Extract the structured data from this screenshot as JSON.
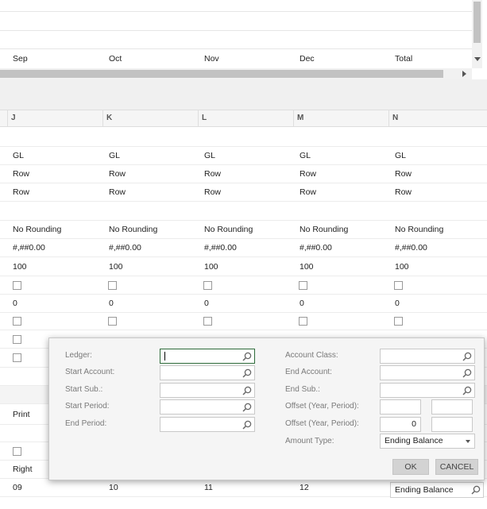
{
  "months": {
    "sep": "Sep",
    "oct": "Oct",
    "nov": "Nov",
    "dec": "Dec",
    "total": "Total"
  },
  "columns": {
    "j": "J",
    "k": "K",
    "l": "L",
    "m": "M",
    "n": "N"
  },
  "grid": {
    "row_gl": [
      "GL",
      "GL",
      "GL",
      "GL",
      "GL"
    ],
    "row_row1": [
      "Row",
      "Row",
      "Row",
      "Row",
      "Row"
    ],
    "row_row2": [
      "Row",
      "Row",
      "Row",
      "Row",
      "Row"
    ],
    "row_rounding": [
      "No Rounding",
      "No Rounding",
      "No Rounding",
      "No Rounding",
      "No Rounding"
    ],
    "row_format": [
      "#,##0.00",
      "#,##0.00",
      "#,##0.00",
      "#,##0.00",
      "#,##0.00"
    ],
    "row_100": [
      "100",
      "100",
      "100",
      "100",
      "100"
    ],
    "row_zero": [
      "0",
      "0",
      "0",
      "0",
      "0"
    ],
    "print_label": "Print",
    "right_label": "Right",
    "periods": [
      "09",
      "10",
      "11",
      "12"
    ],
    "ending_balance": "Ending Balance"
  },
  "dialog": {
    "ledger_label": "Ledger:",
    "start_account_label": "Start Account:",
    "start_sub_label": "Start Sub.:",
    "start_period_label": "Start Period:",
    "end_period_label": "End Period:",
    "account_class_label": "Account Class:",
    "end_account_label": "End Account:",
    "end_sub_label": "End Sub.:",
    "offset1_label": "Offset (Year, Period):",
    "offset2_label": "Offset (Year, Period):",
    "offset2_period_value": "0",
    "amount_type_label": "Amount Type:",
    "amount_type_value": "Ending Balance",
    "ok_label": "OK",
    "cancel_label": "CANCEL"
  },
  "icons": {
    "lookup": "search-icon",
    "dropdown": "chevron-down-icon",
    "scroll_down": "arrow-down-icon",
    "scroll_right": "arrow-right-icon"
  }
}
